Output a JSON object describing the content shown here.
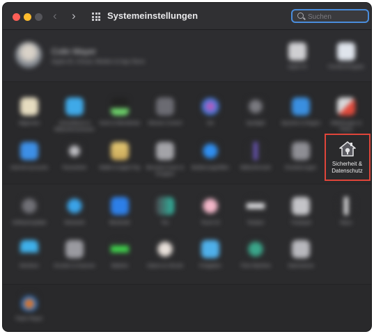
{
  "window": {
    "title": "Systemeinstellungen",
    "search_placeholder": "Suchen"
  },
  "account": {
    "name": "Colin Mayer",
    "subtitle": "Apple-ID, iCloud, Medien & App Store"
  },
  "top_items": [
    {
      "label": "Apple-ID"
    },
    {
      "label": "Familienfreigabe"
    }
  ],
  "row1": [
    {
      "label": "Allgemein"
    },
    {
      "label": "Schreibtisch & Bildschirmschoner"
    },
    {
      "label": "Dock & Menüleiste"
    },
    {
      "label": "Mission Control"
    },
    {
      "label": "Siri"
    },
    {
      "label": "Spotlight"
    },
    {
      "label": "Sprache & Region"
    },
    {
      "label": "Mitteilungen & Fokus"
    }
  ],
  "row2": [
    {
      "label": "Internet-accounts"
    },
    {
      "label": "Passwörter"
    },
    {
      "label": "Wallet & Apple Pay"
    },
    {
      "label": "Benutzer:innen & Gruppen"
    },
    {
      "label": "Bedienungshilfen"
    },
    {
      "label": "Bildschirmzeit"
    },
    {
      "label": "Erweiterungen"
    }
  ],
  "highlighted": {
    "label_line1": "Sicherheit &",
    "label_line2": "Datenschutz"
  },
  "row3": [
    {
      "label": "Softwareupdate"
    },
    {
      "label": "Netzwerk"
    },
    {
      "label": "Bluetooth"
    },
    {
      "label": "Ton"
    },
    {
      "label": "Touch ID"
    },
    {
      "label": "Tastatur"
    },
    {
      "label": "Trackpad"
    },
    {
      "label": "Maus"
    }
  ],
  "row4": [
    {
      "label": "Monitore"
    },
    {
      "label": "Drucker & Scanner"
    },
    {
      "label": "Batterie"
    },
    {
      "label": "Datum & Uhrzeit"
    },
    {
      "label": "Freigaben"
    },
    {
      "label": "Time Machine"
    },
    {
      "label": "Startvolume"
    }
  ],
  "row5": [
    {
      "label": "Flash Player"
    }
  ],
  "colors": {
    "highlight_border": "#e0453a",
    "search_border": "#4a8ddc"
  }
}
